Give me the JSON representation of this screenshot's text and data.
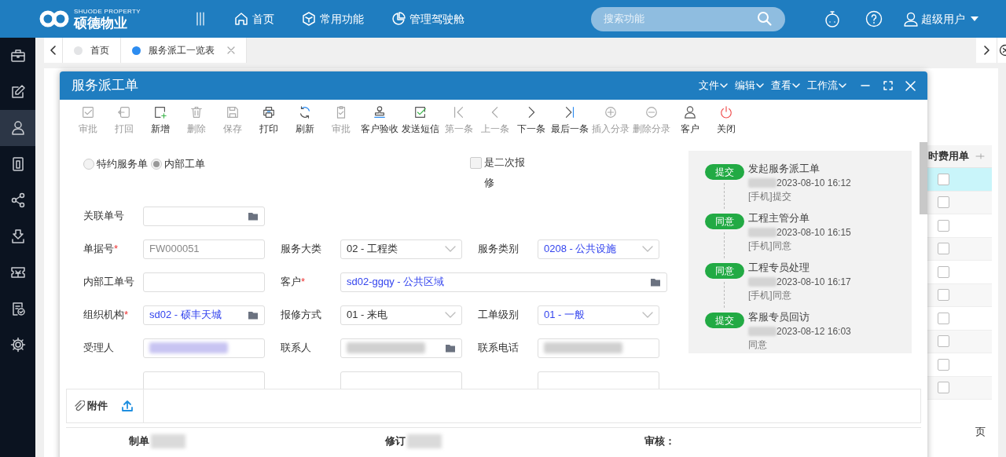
{
  "header": {
    "logo_text": "硕德物业",
    "logo_subtext": "SHUODE PROPERTY",
    "nav": [
      {
        "label": "首页",
        "kind": "home"
      },
      {
        "label": "常用功能",
        "kind": "hexagon"
      },
      {
        "label": "管理驾驶舱",
        "kind": "pie"
      }
    ],
    "search": {
      "placeholder": "搜索功能"
    },
    "user": "超级用户"
  },
  "sidebar": {
    "items": [
      {
        "kind": "briefcase",
        "selected": false
      },
      {
        "kind": "edit",
        "selected": false
      },
      {
        "kind": "user",
        "selected": true
      },
      {
        "kind": "document",
        "selected": false
      },
      {
        "kind": "share",
        "selected": false
      },
      {
        "kind": "download",
        "selected": false
      },
      {
        "kind": "ticket",
        "selected": false
      },
      {
        "kind": "checklist",
        "selected": false
      },
      {
        "kind": "settings",
        "selected": false
      }
    ]
  },
  "tabs": [
    {
      "label": "首页",
      "selected": false
    },
    {
      "label": "服务派工一览表",
      "selected": true
    }
  ],
  "background_table": {
    "column": "时费用单",
    "rows": [
      {
        "selected": true,
        "checked": false
      },
      {
        "selected": false,
        "checked": false
      },
      {
        "selected": false,
        "checked": false
      },
      {
        "selected": false,
        "checked": false
      },
      {
        "selected": false,
        "checked": false
      },
      {
        "selected": false,
        "checked": false
      },
      {
        "selected": false,
        "checked": false
      },
      {
        "selected": false,
        "checked": false
      },
      {
        "selected": false,
        "checked": false
      },
      {
        "selected": false,
        "checked": false
      }
    ],
    "pager_unit": "页"
  },
  "dialog": {
    "title": "服务派工单",
    "menus": [
      "文件",
      "编辑",
      "查看",
      "工作流"
    ],
    "toolbar": [
      {
        "label": "审批",
        "kind": "check",
        "disabled": true
      },
      {
        "label": "打回",
        "kind": "return",
        "disabled": true
      },
      {
        "label": "新增",
        "kind": "add",
        "disabled": false
      },
      {
        "label": "删除",
        "kind": "trash",
        "disabled": true
      },
      {
        "label": "保存",
        "kind": "save",
        "disabled": true
      },
      {
        "label": "打印",
        "kind": "print",
        "disabled": false
      },
      {
        "label": "刷新",
        "kind": "refresh",
        "disabled": false
      },
      {
        "label": "审批",
        "kind": "clipboard",
        "disabled": true
      },
      {
        "label": "客户验收",
        "kind": "stamp",
        "disabled": false
      },
      {
        "label": "发送短信",
        "kind": "check-green",
        "disabled": false
      },
      {
        "label": "第一条",
        "kind": "first",
        "disabled": true
      },
      {
        "label": "上一条",
        "kind": "prev",
        "disabled": true
      },
      {
        "label": "下一条",
        "kind": "next",
        "disabled": false
      },
      {
        "label": "最后一条",
        "kind": "last",
        "disabled": false
      },
      {
        "label": "插入分录",
        "kind": "plus-circle",
        "disabled": true
      },
      {
        "label": "删除分录",
        "kind": "minus-circle",
        "disabled": true
      },
      {
        "label": "客户",
        "kind": "person",
        "disabled": false
      },
      {
        "label": "关闭",
        "kind": "power",
        "disabled": false
      }
    ],
    "order_type": [
      {
        "label": "特约服务单",
        "selected": false
      },
      {
        "label": "内部工单",
        "selected": true
      }
    ],
    "second_repair": {
      "label": "是二次报修",
      "checked": false
    },
    "form_rows": [
      [
        {
          "label": "关联单号",
          "kind": "lookup"
        }
      ],
      [
        {
          "label": "单据号",
          "required_mark": "*",
          "kind": "text",
          "value": "FW000051",
          "readonly": true
        },
        {
          "label": "服务大类",
          "kind": "select",
          "value": "02 - 工程类"
        },
        {
          "label": "服务类别",
          "kind": "select",
          "value": "0208 - 公共设施",
          "linked": true
        }
      ],
      [
        {
          "label": "内部工单号",
          "kind": "text"
        },
        {
          "label": "客户",
          "required_mark": "*",
          "kind": "lookup",
          "value": "sd02-ggqy - 公共区域",
          "linked": true,
          "wide": true
        }
      ],
      [
        {
          "label": "组织机构",
          "required_mark": "*",
          "kind": "lookup",
          "value": "sd02 - 硕丰天城",
          "linked": true
        },
        {
          "label": "报修方式",
          "kind": "select",
          "value": "01 - 来电"
        },
        {
          "label": "工单级别",
          "kind": "select",
          "value": "01 - 一般",
          "linked": true
        }
      ],
      [
        {
          "label": "受理人",
          "kind": "text",
          "redacted": true
        },
        {
          "label": "联系人",
          "kind": "lookup",
          "redacted": true
        },
        {
          "label": "联系电话",
          "kind": "text",
          "redacted": true
        }
      ],
      [
        {
          "kind": "text"
        },
        {
          "kind": "text"
        },
        {
          "kind": "text"
        }
      ]
    ],
    "timeline": [
      {
        "action": "提交",
        "step": "发起服务派工单",
        "time": "2023-08-10 16:12",
        "note": "[手机]提交"
      },
      {
        "action": "同意",
        "step": "工程主管分单",
        "time": "2023-08-10 16:15",
        "note": "[手机]同意"
      },
      {
        "action": "同意",
        "step": "工程专员处理",
        "time": "2023-08-10 16:17",
        "note": "[手机]同意"
      },
      {
        "action": "提交",
        "step": "客服专员回访",
        "time": "2023-08-12 16:03",
        "note": "同意"
      }
    ],
    "attachment": {
      "label": "附件"
    },
    "footer": [
      {
        "label": "制单",
        "redacted": true
      },
      {
        "label": "修订",
        "redacted": true
      },
      {
        "label": "审核："
      }
    ]
  }
}
